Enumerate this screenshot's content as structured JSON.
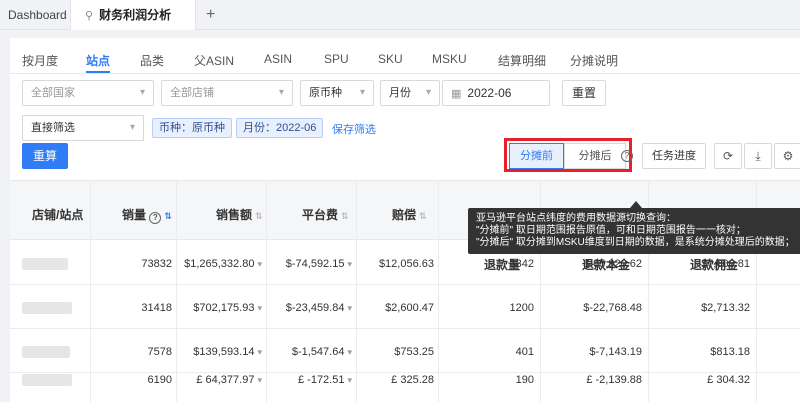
{
  "topbar": {
    "dashboard": "Dashboard",
    "active_tab": "财务利润分析",
    "pin_icon": "⚲",
    "add": "+"
  },
  "subtabs": [
    "按月度",
    "站点",
    "品类",
    "父ASIN",
    "ASIN",
    "SPU",
    "SKU",
    "MSKU",
    "结算明细",
    "分摊说明"
  ],
  "filters": {
    "country_placeholder": "全部国家",
    "store_placeholder": "全部店铺",
    "currency": "原币种",
    "period_type": "月份",
    "date": "2022-06",
    "reset": "重置",
    "quick_filter": "直接筛选",
    "tag_currency": "币种：原币种",
    "tag_month": "月份：2022-06",
    "save_filter": "保存筛选",
    "recalc": "重算"
  },
  "toggle": {
    "before": "分摊前",
    "after": "分摊后"
  },
  "toolbar": {
    "task_progress": "任务进度"
  },
  "tooltip": {
    "line1": "亚马逊平台站点纬度的费用数据源切换查询：",
    "line2": "\"分摊前\" 取日期范围报告原值，可和日期范围报告一一核对；",
    "line3": "\"分摊后\" 取分摊到MSKU维度到日期的数据，是系统分摊处理后的数据；"
  },
  "table": {
    "headers": {
      "store": "店铺/站点",
      "qty": "销量",
      "sales": "销售额",
      "platform_fee": "平台费",
      "compensation": "赔偿",
      "refund_qty": "退款量",
      "refund_principal": "退款本金",
      "refund_commission": "退款佣金"
    },
    "rows": [
      {
        "qty": "73832",
        "sales": "$1,265,332.80",
        "platform_fee": "$-74,592.15",
        "compensation": "$12,056.63",
        "refund_qty": "3342",
        "refund_principal": "$-65,920.62",
        "refund_commission": "$7,608.81"
      },
      {
        "qty": "31418",
        "sales": "$702,175.93",
        "platform_fee": "$-23,459.84",
        "compensation": "$2,600.47",
        "refund_qty": "1200",
        "refund_principal": "$-22,768.48",
        "refund_commission": "$2,713.32"
      },
      {
        "qty": "7578",
        "sales": "$139,593.14",
        "platform_fee": "$-1,547.64",
        "compensation": "$753.25",
        "refund_qty": "401",
        "refund_principal": "$-7,143.19",
        "refund_commission": "$813.18"
      },
      {
        "qty": "6190",
        "sales": "£ 64,377.97",
        "platform_fee": "£ -172.51",
        "compensation": "£ 325.28",
        "refund_qty": "190",
        "refund_principal": "£ -2,139.88",
        "refund_commission": "£ 304.32"
      }
    ]
  },
  "colors": {
    "accent": "#2f7cf6",
    "highlight_border": "#e8202a"
  }
}
